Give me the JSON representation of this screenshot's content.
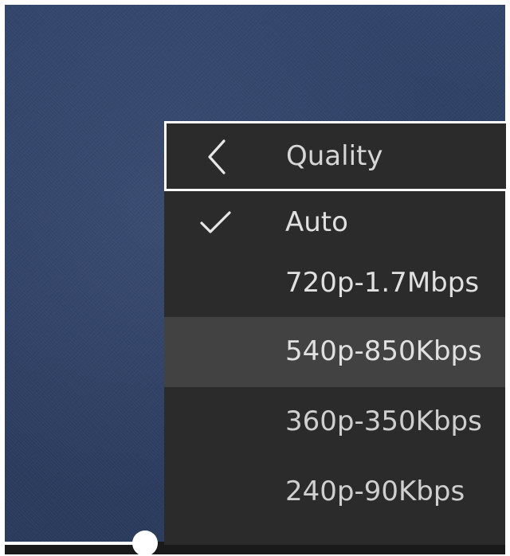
{
  "player": {
    "seek_progress": 0.28
  },
  "quality_menu": {
    "title": "Quality",
    "back_icon": "chevron-left-icon",
    "check_icon": "checkmark-icon",
    "options": [
      {
        "label": "Auto",
        "selected": true
      },
      {
        "label": "720p-1.7Mbps",
        "selected": false
      },
      {
        "label": "540p-850Kbps",
        "selected": false,
        "hovered": true
      },
      {
        "label": "360p-350Kbps",
        "selected": false
      },
      {
        "label": "240p-90Kbps",
        "selected": false
      }
    ]
  },
  "colors": {
    "menu_background": "#2b2b2b",
    "menu_hover": "#424242",
    "menu_text": "#e0e0e0",
    "focus_border": "#ffffff",
    "video_background": "#2d3f62"
  }
}
